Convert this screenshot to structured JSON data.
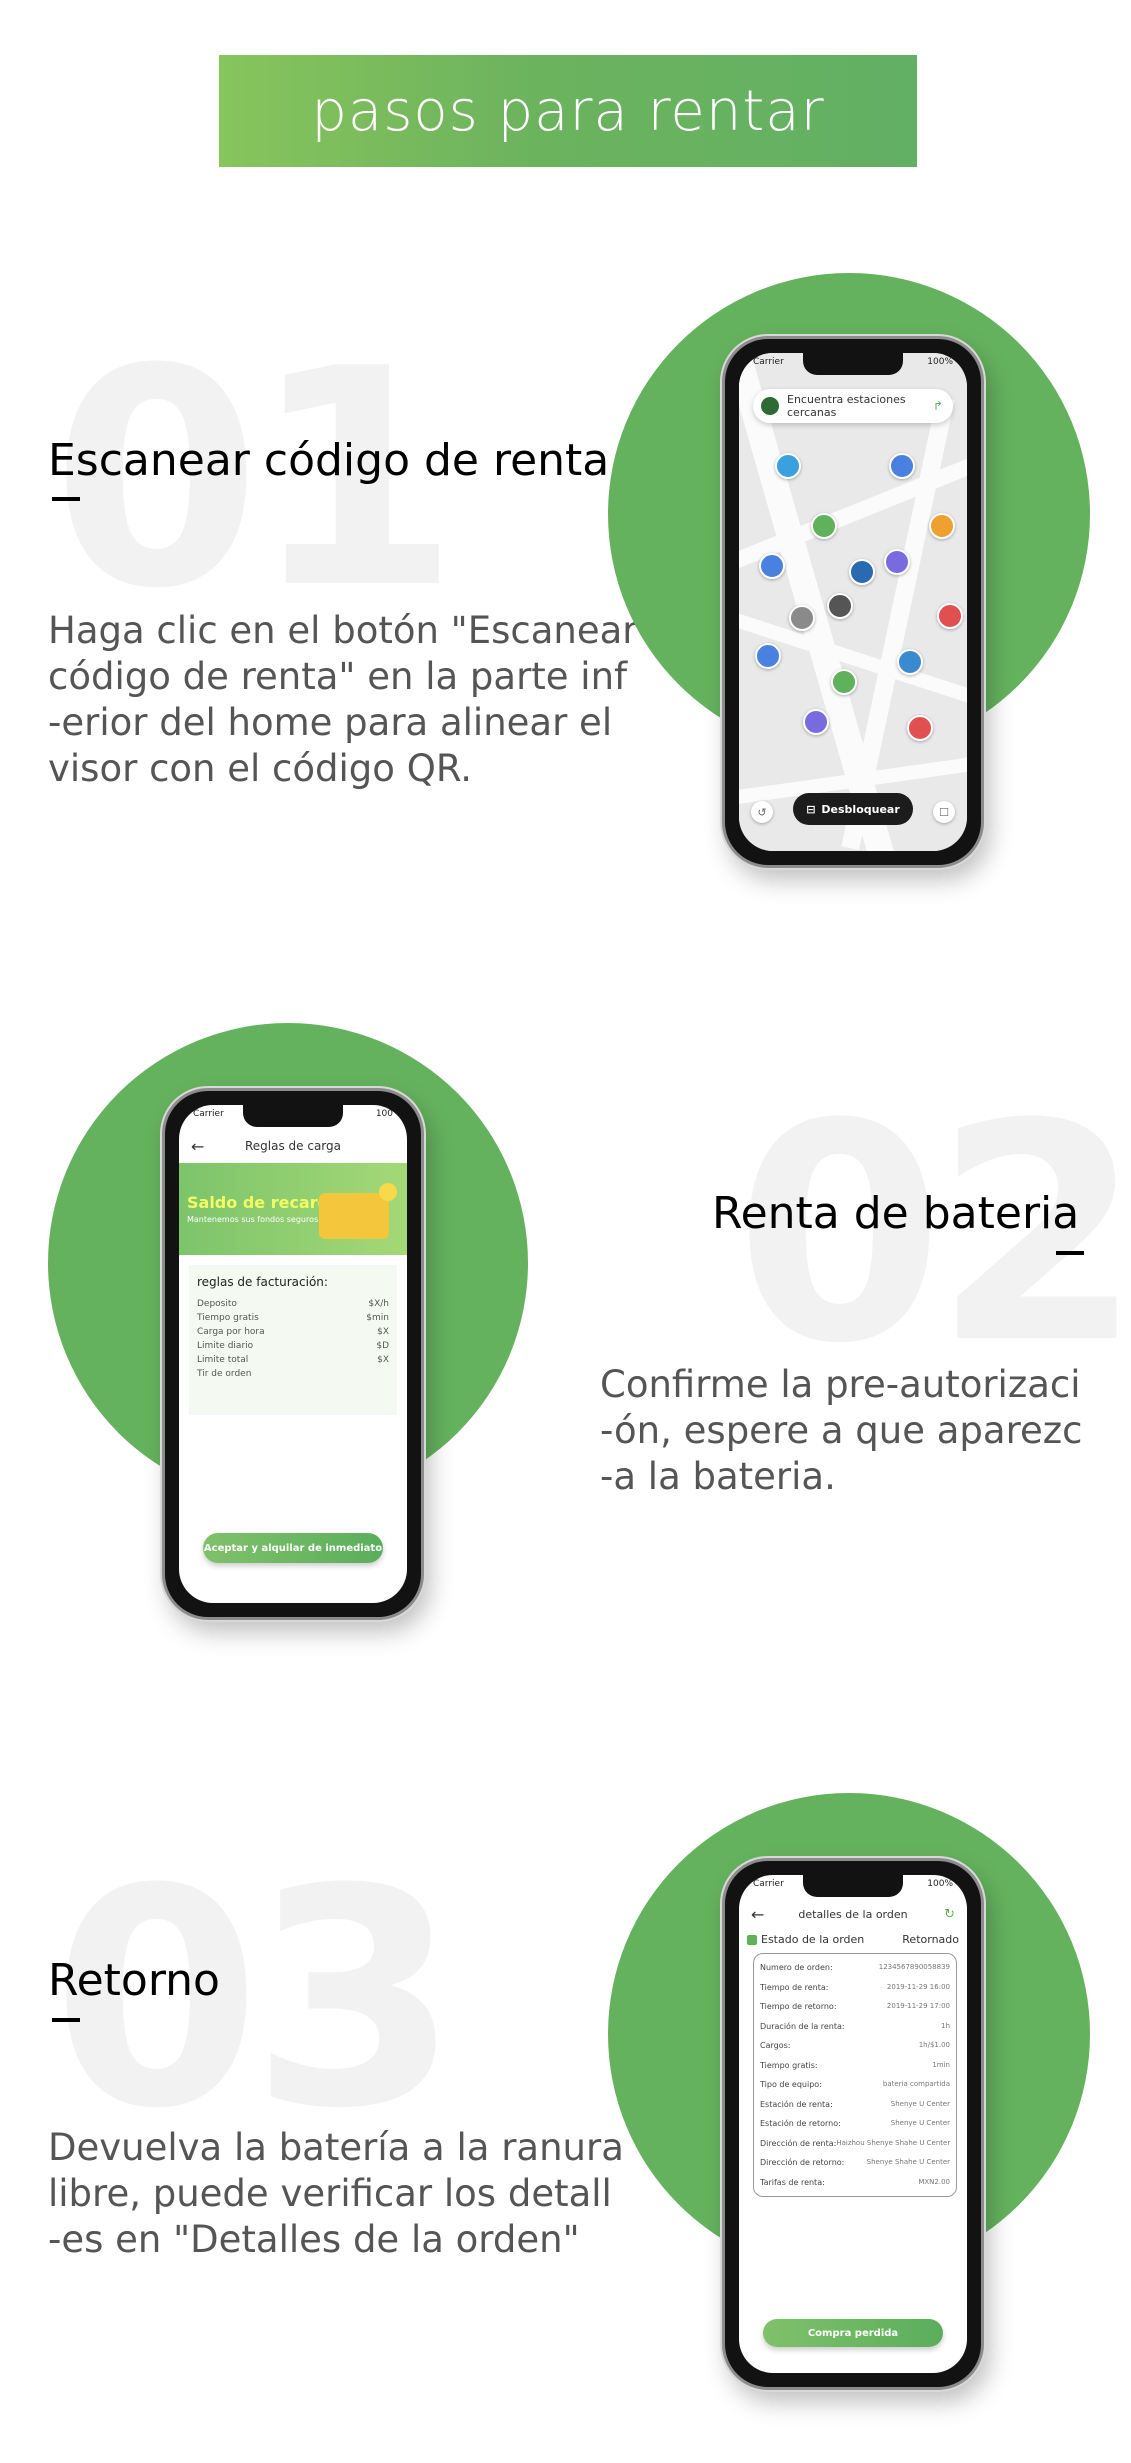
{
  "banner": {
    "title": "pasos para rentar"
  },
  "steps": [
    {
      "number": "01",
      "title": "Escanear código de renta",
      "text": "Haga clic en el botón \"Escanear\ncódigo de renta\" en la parte inf\n-erior del home para alinear el\nvisor con el código QR."
    },
    {
      "number": "02",
      "title": "Renta de bateria",
      "text": "Confirme la pre-autorizaci\n-ón, espere a que aparezc\n-a la bateria."
    },
    {
      "number": "03",
      "title": "Retorno",
      "text": "Devuelva la batería a la ranura\nlibre, puede verificar los detall\n-es en \"Detalles de la orden\""
    }
  ],
  "phone1": {
    "search_text": "Encuentra estaciones cercanas",
    "unlock_label": "Desbloquear",
    "status_left": "Carrier",
    "status_right": "100%"
  },
  "phone2": {
    "status_left": "Carrier",
    "status_right": "100",
    "header": "Reglas de carga",
    "promo_title": "Saldo de recarga",
    "promo_sub": "Mantenemos sus fondos seguros",
    "billing_title": "reglas de facturación:",
    "billing_rows": [
      {
        "label": "Deposito",
        "value": "$X/h"
      },
      {
        "label": "Tiempo gratis",
        "value": "$min"
      },
      {
        "label": "Carga por hora",
        "value": "$X"
      },
      {
        "label": "Limite diario",
        "value": "$D"
      },
      {
        "label": "Limite total",
        "value": "$X"
      },
      {
        "label": "Tir de orden",
        "value": ""
      }
    ],
    "accept_button": "Aceptar y alquilar de inmediato"
  },
  "phone3": {
    "status_left": "Carrier",
    "status_right": "100%",
    "header": "detalles de la orden",
    "status_label": "Estado de la orden",
    "status_value": "Retornado",
    "rows": [
      {
        "label": "Numero de orden:",
        "value": "1234567890058839"
      },
      {
        "label": "Tiempo de renta:",
        "value": "2019-11-29 16:00"
      },
      {
        "label": "Tiempo de retorno:",
        "value": "2019-11-29 17:00"
      },
      {
        "label": "Duración de la renta:",
        "value": "1h"
      },
      {
        "label": "Cargos:",
        "value": "1h/$1.00"
      },
      {
        "label": "Tiempo gratis:",
        "value": "1min"
      },
      {
        "label": "Tipo de equipo:",
        "value": "bateria compartida"
      },
      {
        "label": "Estación de renta:",
        "value": "Shenye U Center"
      },
      {
        "label": "Estación de retorno:",
        "value": "Shenye U Center"
      },
      {
        "label": "Dirección de renta:",
        "value": "Haizhou Shenye Shahe U Center"
      },
      {
        "label": "Dirección de retorno:",
        "value": "Shenye Shahe U Center"
      },
      {
        "label": "Tarifas de renta:",
        "value": "MXN2.00"
      }
    ],
    "lost_button": "Compra perdida"
  },
  "colors": {
    "accent": "#64b25e",
    "banner_start": "#87c45c",
    "banner_end": "#62b064"
  },
  "icons": [
    "logo-icon",
    "location-arrow-icon",
    "map-pin-icon",
    "unlock-scan-icon",
    "history-icon",
    "profile-icon",
    "back-arrow-icon",
    "refresh-icon"
  ]
}
